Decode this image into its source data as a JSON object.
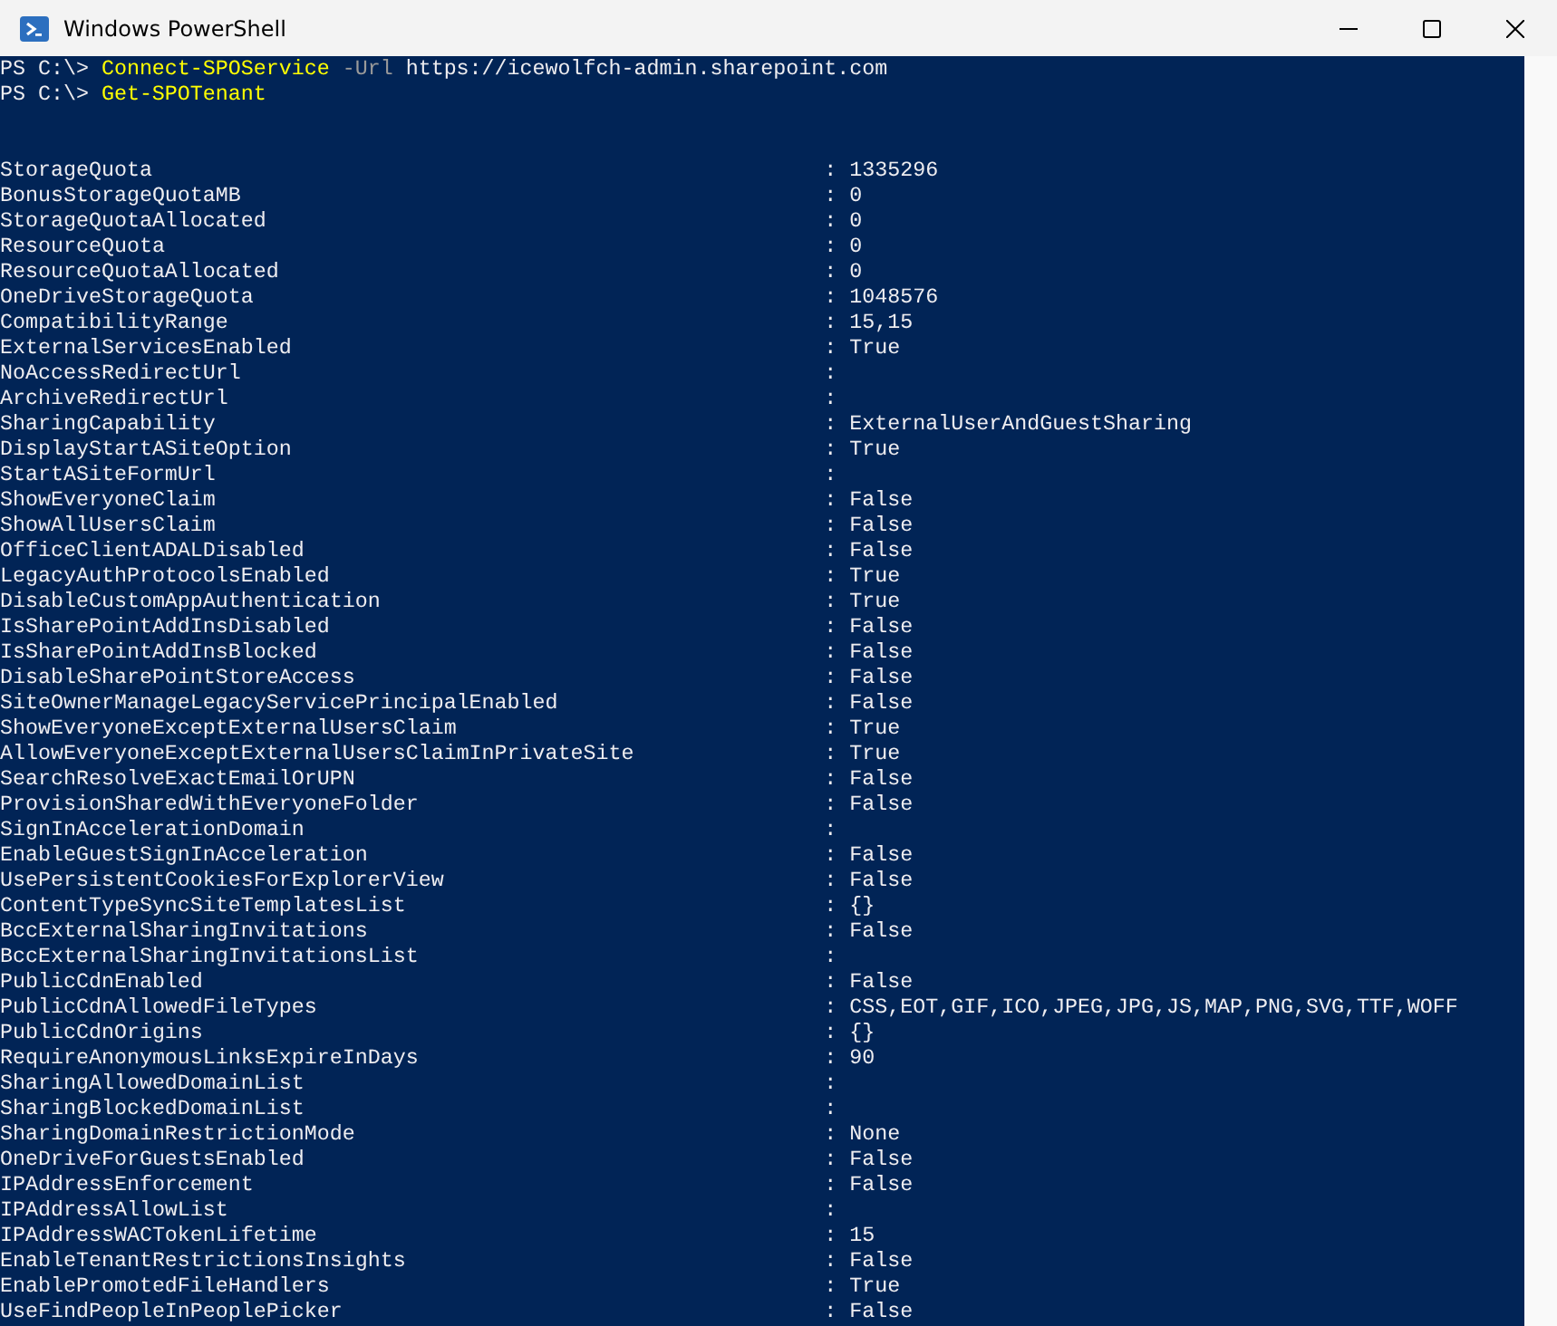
{
  "window": {
    "title": "Windows PowerShell"
  },
  "commands": [
    {
      "prompt": "PS C:\\>",
      "tokens": [
        {
          "kind": "command",
          "text": "Connect-SPOService"
        },
        {
          "kind": "parameter",
          "text": "-Url"
        },
        {
          "kind": "argument",
          "text": "https://icewolfch-admin.sharepoint.com"
        }
      ]
    },
    {
      "prompt": "PS C:\\>",
      "tokens": [
        {
          "kind": "command",
          "text": "Get-SPOTenant"
        }
      ]
    }
  ],
  "properties": [
    {
      "name": "StorageQuota",
      "value": ": 1335296"
    },
    {
      "name": "BonusStorageQuotaMB",
      "value": ": 0"
    },
    {
      "name": "StorageQuotaAllocated",
      "value": ": 0"
    },
    {
      "name": "ResourceQuota",
      "value": ": 0"
    },
    {
      "name": "ResourceQuotaAllocated",
      "value": ": 0"
    },
    {
      "name": "OneDriveStorageQuota",
      "value": ": 1048576"
    },
    {
      "name": "CompatibilityRange",
      "value": ": 15,15"
    },
    {
      "name": "ExternalServicesEnabled",
      "value": ": True"
    },
    {
      "name": "NoAccessRedirectUrl",
      "value": ":"
    },
    {
      "name": "ArchiveRedirectUrl",
      "value": ":"
    },
    {
      "name": "SharingCapability",
      "value": ": ExternalUserAndGuestSharing"
    },
    {
      "name": "DisplayStartASiteOption",
      "value": ": True"
    },
    {
      "name": "StartASiteFormUrl",
      "value": ":"
    },
    {
      "name": "ShowEveryoneClaim",
      "value": ": False"
    },
    {
      "name": "ShowAllUsersClaim",
      "value": ": False"
    },
    {
      "name": "OfficeClientADALDisabled",
      "value": ": False"
    },
    {
      "name": "LegacyAuthProtocolsEnabled",
      "value": ": True"
    },
    {
      "name": "DisableCustomAppAuthentication",
      "value": ": True"
    },
    {
      "name": "IsSharePointAddInsDisabled",
      "value": ": False"
    },
    {
      "name": "IsSharePointAddInsBlocked",
      "value": ": False"
    },
    {
      "name": "DisableSharePointStoreAccess",
      "value": ": False"
    },
    {
      "name": "SiteOwnerManageLegacyServicePrincipalEnabled",
      "value": ": False"
    },
    {
      "name": "ShowEveryoneExceptExternalUsersClaim",
      "value": ": True"
    },
    {
      "name": "AllowEveryoneExceptExternalUsersClaimInPrivateSite",
      "value": ": True"
    },
    {
      "name": "SearchResolveExactEmailOrUPN",
      "value": ": False"
    },
    {
      "name": "ProvisionSharedWithEveryoneFolder",
      "value": ": False"
    },
    {
      "name": "SignInAccelerationDomain",
      "value": ":"
    },
    {
      "name": "EnableGuestSignInAcceleration",
      "value": ": False"
    },
    {
      "name": "UsePersistentCookiesForExplorerView",
      "value": ": False"
    },
    {
      "name": "ContentTypeSyncSiteTemplatesList",
      "value": ": {}"
    },
    {
      "name": "BccExternalSharingInvitations",
      "value": ": False"
    },
    {
      "name": "BccExternalSharingInvitationsList",
      "value": ":"
    },
    {
      "name": "PublicCdnEnabled",
      "value": ": False"
    },
    {
      "name": "PublicCdnAllowedFileTypes",
      "value": ": CSS,EOT,GIF,ICO,JPEG,JPG,JS,MAP,PNG,SVG,TTF,WOFF"
    },
    {
      "name": "PublicCdnOrigins",
      "value": ": {}"
    },
    {
      "name": "RequireAnonymousLinksExpireInDays",
      "value": ": 90"
    },
    {
      "name": "SharingAllowedDomainList",
      "value": ":"
    },
    {
      "name": "SharingBlockedDomainList",
      "value": ":"
    },
    {
      "name": "SharingDomainRestrictionMode",
      "value": ": None"
    },
    {
      "name": "OneDriveForGuestsEnabled",
      "value": ": False"
    },
    {
      "name": "IPAddressEnforcement",
      "value": ": False"
    },
    {
      "name": "IPAddressAllowList",
      "value": ":"
    },
    {
      "name": "IPAddressWACTokenLifetime",
      "value": ": 15"
    },
    {
      "name": "EnableTenantRestrictionsInsights",
      "value": ": False"
    },
    {
      "name": "EnablePromotedFileHandlers",
      "value": ": True"
    },
    {
      "name": "UseFindPeopleInPeoplePicker",
      "value": ": False"
    }
  ]
}
